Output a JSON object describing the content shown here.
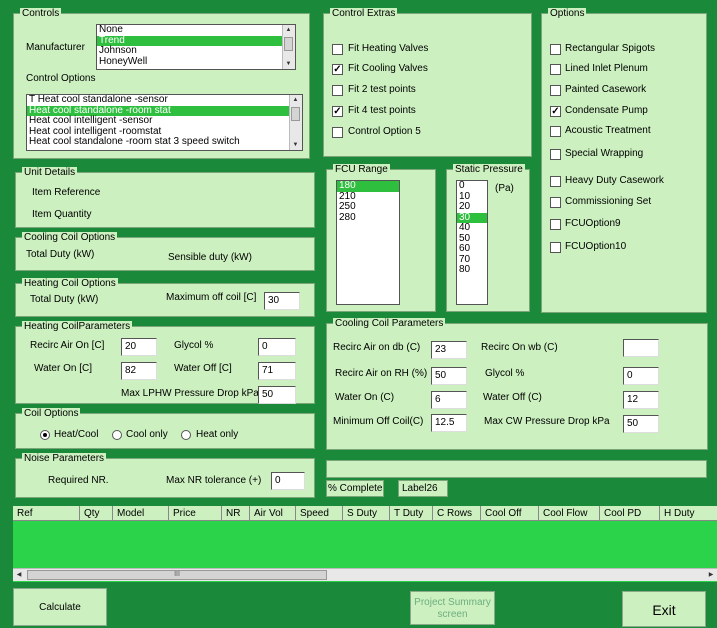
{
  "controls": {
    "title": "Controls",
    "manufacturer_label": "Manufacturer",
    "manufacturers": [
      "None",
      "Trend",
      "Johnson",
      "HoneyWell"
    ],
    "control_options_label": "Control Options",
    "control_options": [
      "T Heat cool standalone -sensor",
      "Heat cool standalone -room stat",
      "Heat cool intelligent -sensor",
      "Heat cool intelligent -roomstat",
      "Heat cool standalone -room stat 3 speed switch"
    ]
  },
  "control_extras": {
    "title": "Control Extras",
    "items": [
      {
        "label": "Fit Heating Valves",
        "checked": false
      },
      {
        "label": "Fit Cooling Valves",
        "checked": true
      },
      {
        "label": "Fit 2 test points",
        "checked": false
      },
      {
        "label": "Fit 4 test points",
        "checked": true
      },
      {
        "label": "Control Option 5",
        "checked": false
      }
    ]
  },
  "options": {
    "title": "Options",
    "items": [
      {
        "label": "Rectangular Spigots",
        "checked": false
      },
      {
        "label": "Lined Inlet Plenum",
        "checked": false
      },
      {
        "label": "Painted Casework",
        "checked": false
      },
      {
        "label": "Condensate Pump",
        "checked": true
      },
      {
        "label": "Acoustic Treatment",
        "checked": false
      },
      {
        "label": "Special Wrapping",
        "checked": false
      },
      {
        "label": "Heavy Duty Casework",
        "checked": false
      },
      {
        "label": "Commissioning Set",
        "checked": false
      },
      {
        "label": "FCUOption9",
        "checked": false
      },
      {
        "label": "FCUOption10",
        "checked": false
      }
    ]
  },
  "fcu_range": {
    "title": "FCU Range",
    "items": [
      "180",
      "210",
      "250",
      "280"
    ]
  },
  "static_pressure": {
    "title": "Static Pressure",
    "unit": "(Pa)",
    "items": [
      "0",
      "10",
      "20",
      "30",
      "40",
      "50",
      "60",
      "70",
      "80"
    ]
  },
  "unit_details": {
    "title": "Unit Details",
    "item_reference": "Item Reference",
    "item_quantity": "Item Quantity"
  },
  "cooling_coil_options": {
    "title": "Cooling Coil Options",
    "total_duty": "Total Duty (kW)",
    "sensible_duty": "Sensible duty (kW)"
  },
  "heating_coil_options": {
    "title": "Heating Coil Options",
    "total_duty": "Total Duty (kW)",
    "max_off_label": "Maximum off coil [C]",
    "max_off_value": "30"
  },
  "heating_params": {
    "title": "Heating CoilParameters",
    "recirc_label": "Recirc Air On [C]",
    "recirc_value": "20",
    "glycol_label": "Glycol %",
    "glycol_value": "0",
    "water_on_label": "Water On [C]",
    "water_on_value": "82",
    "water_off_label": "Water Off [C]",
    "water_off_value": "71",
    "lphw_label": "Max LPHW Pressure Drop kPa",
    "lphw_value": "50"
  },
  "coil_options": {
    "title": "Coil Options",
    "choices": [
      {
        "label": "Heat/Cool",
        "selected": true
      },
      {
        "label": "Cool only",
        "selected": false
      },
      {
        "label": "Heat only",
        "selected": false
      }
    ]
  },
  "noise": {
    "title": "Noise Parameters",
    "required_nr": "Required NR.",
    "max_nr_label": "Max NR tolerance (+)",
    "max_nr_value": "0"
  },
  "cooling_params": {
    "title": "Cooling Coil Parameters",
    "db_label": "Recirc Air on db (C)",
    "db_value": "23",
    "wb_label": "Recirc On wb (C)",
    "wb_value": "",
    "rh_label": "Recirc Air on RH (%)",
    "rh_value": "50",
    "glycol_label": "Glycol %",
    "glycol_value": "0",
    "water_on_label": "Water On (C)",
    "water_on_value": "6",
    "water_off_label": "Water Off (C)",
    "water_off_value": "12",
    "min_off_label": "Minimum Off Coil(C)",
    "min_off_value": "12.5",
    "cw_label": "Max CW Pressure Drop kPa",
    "cw_value": "50"
  },
  "progress": {
    "complete_label": "% Complete",
    "label26": "Label26"
  },
  "grid": {
    "columns": [
      "Ref",
      "Qty",
      "Model",
      "Price",
      "NR",
      "Air Vol",
      "Speed",
      "S Duty",
      "T Duty",
      "C Rows",
      "Cool Off",
      "Cool Flow",
      "Cool PD",
      "H Duty"
    ]
  },
  "scrollbar": {
    "thumb_glyph": "III"
  },
  "buttons": {
    "calculate": "Calculate",
    "summary": "Project Summary screen",
    "exit": "Exit"
  },
  "colors": {
    "background": "#1a8a3a",
    "panel": "#ccf0c0",
    "selection": "#2fbf3f"
  }
}
